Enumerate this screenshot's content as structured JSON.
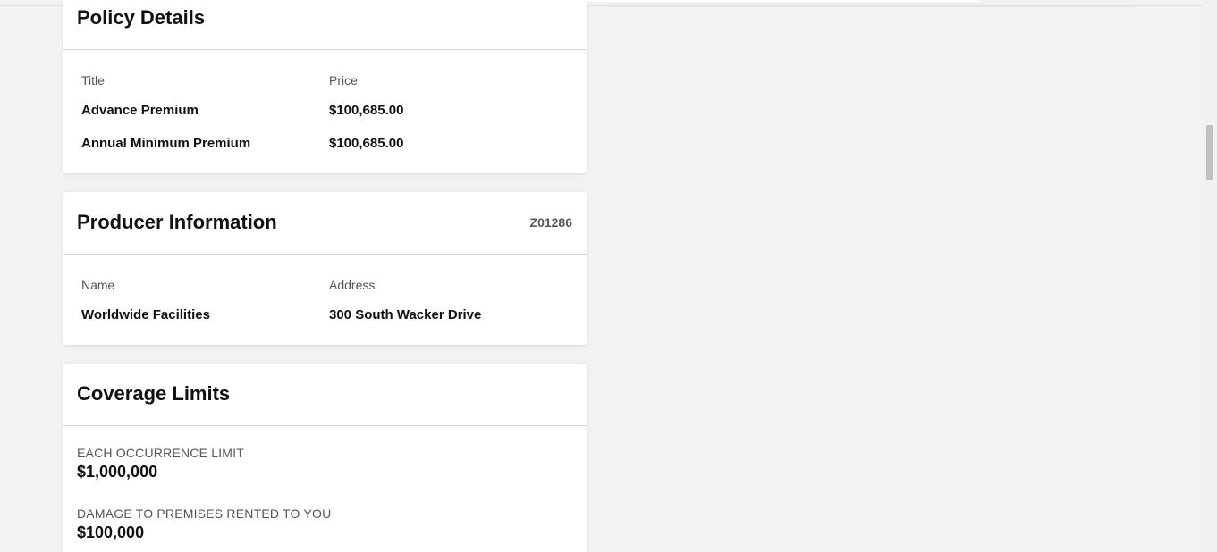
{
  "policy_details": {
    "title": "Policy Details",
    "columns": {
      "title": "Title",
      "price": "Price"
    },
    "rows": [
      {
        "title": "Advance Premium",
        "price": "$100,685.00"
      },
      {
        "title": "Annual Minimum Premium",
        "price": "$100,685.00"
      }
    ]
  },
  "producer_information": {
    "title": "Producer Information",
    "code": "Z01286",
    "columns": {
      "name": "Name",
      "address": "Address"
    },
    "row": {
      "name": "Worldwide Facilities",
      "address": "300 South Wacker Drive"
    }
  },
  "coverage_limits": {
    "title": "Coverage Limits",
    "items": [
      {
        "label": "EACH OCCURRENCE LIMIT",
        "value": "$1,000,000"
      },
      {
        "label": "DAMAGE TO PREMISES RENTED TO YOU",
        "value": "$100,000"
      }
    ]
  },
  "colors": {
    "background": "#f2f2f2",
    "card": "#ffffff",
    "label": "#555555",
    "text": "#111111"
  }
}
